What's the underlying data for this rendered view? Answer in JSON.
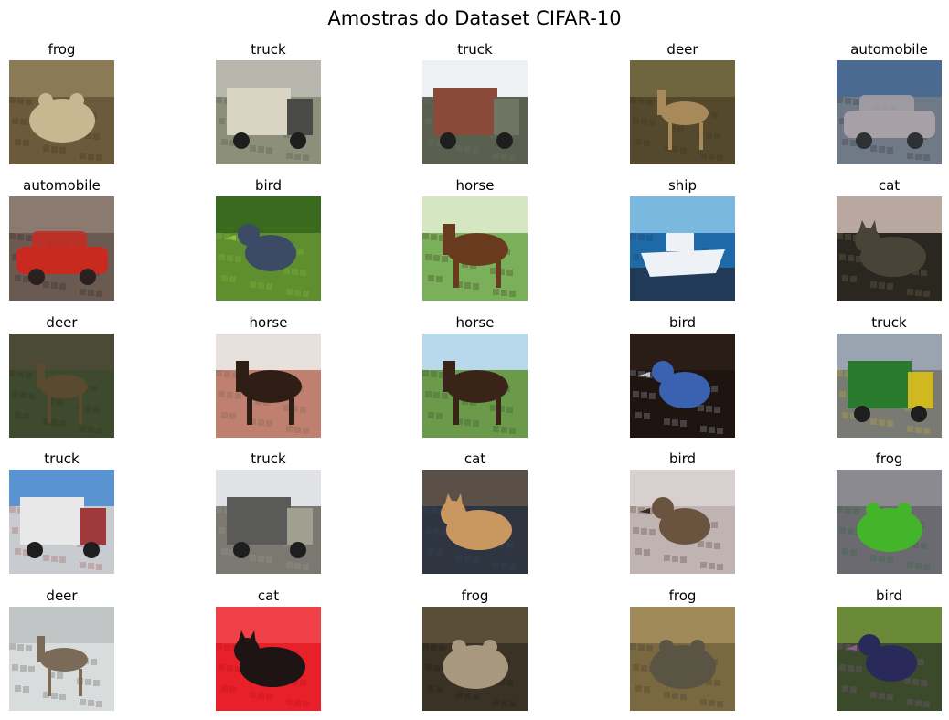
{
  "figure": {
    "title": "Amostras do Dataset CIFAR-10"
  },
  "samples": [
    {
      "label": "frog",
      "subject": "frog",
      "colors": {
        "bg": "#6b5a3c",
        "top": "#8a7a55",
        "fg": "#c8b892",
        "accent": "#3a2f1e"
      }
    },
    {
      "label": "truck",
      "subject": "truck",
      "colors": {
        "bg": "#8c8f7a",
        "top": "#b8b7ad",
        "fg": "#d9d4c4",
        "accent": "#4a4a48"
      }
    },
    {
      "label": "truck",
      "subject": "truck",
      "colors": {
        "bg": "#5a6050",
        "top": "#eef0f4",
        "fg": "#8a4a3a",
        "accent": "#6f7562"
      }
    },
    {
      "label": "deer",
      "subject": "deer",
      "colors": {
        "bg": "#55492d",
        "top": "#6f6640",
        "fg": "#a88a5a",
        "accent": "#3a2f1d"
      }
    },
    {
      "label": "automobile",
      "subject": "car",
      "colors": {
        "bg": "#6f7a86",
        "top": "#4a6a92",
        "fg": "#a7a0a6",
        "accent": "#2d3034"
      }
    },
    {
      "label": "automobile",
      "subject": "car",
      "colors": {
        "bg": "#6a5a52",
        "top": "#8a7a70",
        "fg": "#c92a20",
        "accent": "#2a2020"
      }
    },
    {
      "label": "bird",
      "subject": "bird",
      "colors": {
        "bg": "#5e8e2e",
        "top": "#3a6a1e",
        "fg": "#3c4a66",
        "accent": "#90c040"
      }
    },
    {
      "label": "horse",
      "subject": "horse",
      "colors": {
        "bg": "#7ab05a",
        "top": "#d4e6c2",
        "fg": "#6a3a1e",
        "accent": "#3a2414"
      }
    },
    {
      "label": "ship",
      "subject": "ship",
      "colors": {
        "bg": "#1e6aa8",
        "top": "#7ab8e0",
        "fg": "#eef2f6",
        "accent": "#203a58"
      }
    },
    {
      "label": "cat",
      "subject": "cat",
      "colors": {
        "bg": "#2a2620",
        "top": "#b8a8a0",
        "fg": "#4a4438",
        "accent": "#8a7a60"
      }
    },
    {
      "label": "deer",
      "subject": "deer",
      "colors": {
        "bg": "#3e4a2e",
        "top": "#4a4a36",
        "fg": "#5a4a30",
        "accent": "#2a3020"
      }
    },
    {
      "label": "horse",
      "subject": "horse",
      "colors": {
        "bg": "#c08070",
        "top": "#e8e0dc",
        "fg": "#2e1e16",
        "accent": "#6a5a4a"
      }
    },
    {
      "label": "horse",
      "subject": "horse",
      "colors": {
        "bg": "#6a9a4a",
        "top": "#b8d8ec",
        "fg": "#3a2418",
        "accent": "#2a4a2a"
      }
    },
    {
      "label": "bird",
      "subject": "bird",
      "colors": {
        "bg": "#1e1410",
        "top": "#2a1c16",
        "fg": "#3a62b0",
        "accent": "#c0c6d0"
      }
    },
    {
      "label": "truck",
      "subject": "truck",
      "colors": {
        "bg": "#7a7a74",
        "top": "#9aa4b0",
        "fg": "#2a7a2e",
        "accent": "#d0b820"
      }
    },
    {
      "label": "truck",
      "subject": "truck",
      "colors": {
        "bg": "#c8ccd0",
        "top": "#5a94d0",
        "fg": "#e8e8e8",
        "accent": "#a03a3a"
      }
    },
    {
      "label": "truck",
      "subject": "truck",
      "colors": {
        "bg": "#7a7870",
        "top": "#e0e2e6",
        "fg": "#5a5a58",
        "accent": "#a0a090"
      }
    },
    {
      "label": "cat",
      "subject": "cat",
      "colors": {
        "bg": "#2e3440",
        "top": "#5a5048",
        "fg": "#c89860",
        "accent": "#3a4660"
      }
    },
    {
      "label": "bird",
      "subject": "bird",
      "colors": {
        "bg": "#c0b4b2",
        "top": "#d8d0ce",
        "fg": "#6a5440",
        "accent": "#3a2c20"
      }
    },
    {
      "label": "frog",
      "subject": "frog",
      "colors": {
        "bg": "#6a6a70",
        "top": "#8a8a90",
        "fg": "#44b42a",
        "accent": "#2a6a3a"
      }
    },
    {
      "label": "deer",
      "subject": "deer",
      "colors": {
        "bg": "#d8dcdc",
        "top": "#c0c4c4",
        "fg": "#7a6a58",
        "accent": "#4a4038"
      }
    },
    {
      "label": "cat",
      "subject": "cat",
      "colors": {
        "bg": "#e8202a",
        "top": "#f04048",
        "fg": "#1e1414",
        "accent": "#b0101a"
      }
    },
    {
      "label": "frog",
      "subject": "frog",
      "colors": {
        "bg": "#3a3224",
        "top": "#5a4e38",
        "fg": "#a89880",
        "accent": "#201a12"
      }
    },
    {
      "label": "frog",
      "subject": "frog",
      "colors": {
        "bg": "#7a6840",
        "top": "#a08a5a",
        "fg": "#5a5444",
        "accent": "#3a3226"
      }
    },
    {
      "label": "bird",
      "subject": "bird",
      "colors": {
        "bg": "#3a4a2a",
        "top": "#6a8a3a",
        "fg": "#2a2a5a",
        "accent": "#8a5a9a"
      }
    }
  ]
}
